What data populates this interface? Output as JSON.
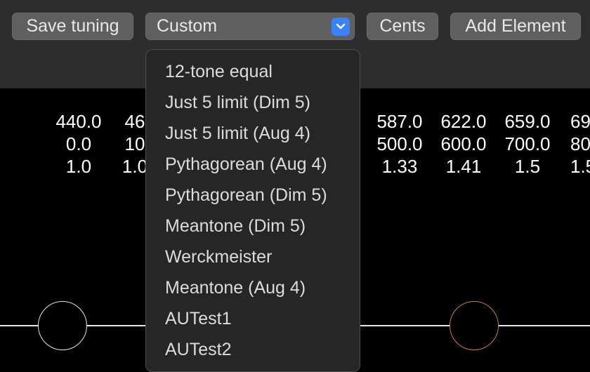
{
  "toolbar": {
    "save_label": "Save tuning",
    "tuning_select": "Custom",
    "cents_label": "Cents",
    "add_element_label": "Add Element"
  },
  "tuning_menu": {
    "items": [
      "12-tone equal",
      "Just 5 limit (Dim 5)",
      "Just 5 limit (Aug 4)",
      "Pythagorean (Aug 4)",
      "Pythagorean (Dim 5)",
      "Meantone (Dim 5)",
      "Werckmeister",
      "Meantone (Aug 4)",
      "AUTest1",
      "AUTest2"
    ]
  },
  "notes": [
    {
      "freq": "440.0",
      "cents": "0.0",
      "ratio": "1.0"
    },
    {
      "freq": "46",
      "cents": "10",
      "ratio": "1.0"
    },
    {
      "freq": "587.0",
      "cents": "500.0",
      "ratio": "1.33"
    },
    {
      "freq": "622.0",
      "cents": "600.0",
      "ratio": "1.41"
    },
    {
      "freq": "659.0",
      "cents": "700.0",
      "ratio": "1.5"
    },
    {
      "freq": "69",
      "cents": "80",
      "ratio": "1.5"
    }
  ],
  "colors": {
    "toolbar_bg": "#2d2d2d",
    "accent": "#3b82f6",
    "knob_selected": "#c8823c"
  }
}
